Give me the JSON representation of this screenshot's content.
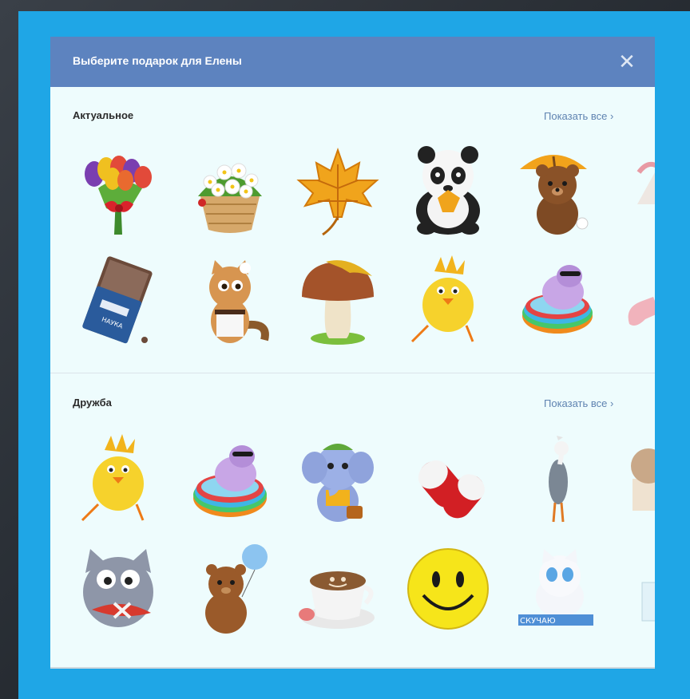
{
  "modal": {
    "title": "Выберите подарок для Елены",
    "close_icon": "close-icon"
  },
  "sections": [
    {
      "title": "Актуальное",
      "show_all_label": "Показать все ›",
      "gifts": [
        {
          "name": "tulip-bouquet"
        },
        {
          "name": "flower-basket"
        },
        {
          "name": "maple-leaf"
        },
        {
          "name": "panda"
        },
        {
          "name": "bear-umbrella"
        },
        {
          "name": "gift-cut"
        },
        {
          "name": "chocolate-bar",
          "label": "НАУКА"
        },
        {
          "name": "cat-maid"
        },
        {
          "name": "mushroom"
        },
        {
          "name": "yellow-chick"
        },
        {
          "name": "hippo-pool"
        },
        {
          "name": "pill-cut"
        }
      ]
    },
    {
      "title": "Дружба",
      "show_all_label": "Показать все ›",
      "gifts": [
        {
          "name": "yellow-chick"
        },
        {
          "name": "hippo-pool"
        },
        {
          "name": "elephant-traveler"
        },
        {
          "name": "pill"
        },
        {
          "name": "stork"
        },
        {
          "name": "kitten-box-cut"
        },
        {
          "name": "grey-cat-fish"
        },
        {
          "name": "winnie-balloon"
        },
        {
          "name": "coffee-cup"
        },
        {
          "name": "smiley"
        },
        {
          "name": "white-kitten-blocks",
          "label": "СКУЧАЮ"
        },
        {
          "name": "glass-cut"
        }
      ]
    }
  ]
}
